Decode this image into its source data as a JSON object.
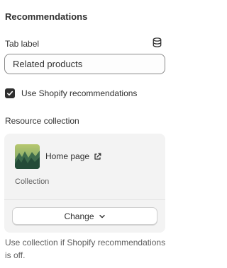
{
  "section": {
    "title": "Recommendations"
  },
  "tab_label": {
    "label": "Tab label",
    "value": "Related products",
    "icon": "database-icon"
  },
  "recommendations_checkbox": {
    "checked": true,
    "label": "Use Shopify recommendations"
  },
  "resource": {
    "label": "Resource collection",
    "title": "Home page",
    "type": "Collection",
    "change_label": "Change",
    "link_icon": "external-link-icon",
    "chevron_icon": "chevron-down-icon"
  },
  "help": {
    "text": "Use collection if Shopify recommendations is off."
  },
  "colors": {
    "text": "#303030",
    "subdued": "#616161",
    "card_bg": "#f3f3f3",
    "border": "#8a8a8a"
  }
}
